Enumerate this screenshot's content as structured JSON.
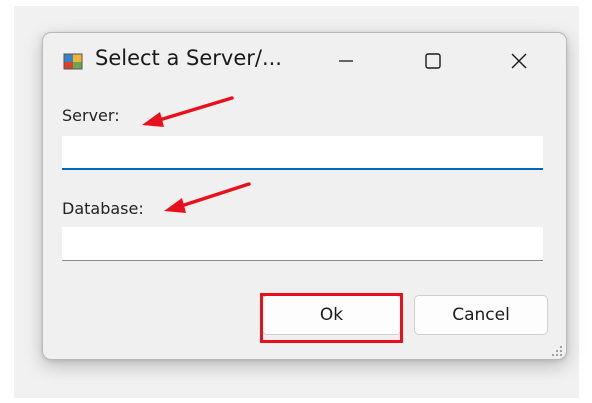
{
  "window": {
    "title": "Select a Server/...",
    "icon": "app-window-icon",
    "controls": {
      "minimize_icon": "minimize-icon",
      "maximize_icon": "maximize-icon",
      "close_icon": "close-icon"
    }
  },
  "form": {
    "server_label": "Server:",
    "server_value": "",
    "database_label": "Database:",
    "database_value": ""
  },
  "buttons": {
    "ok_label": "Ok",
    "cancel_label": "Cancel"
  },
  "colors": {
    "annotation": "#e8101d",
    "focus_accent": "#0067c0",
    "dialog_background": "#f0f0f0"
  }
}
